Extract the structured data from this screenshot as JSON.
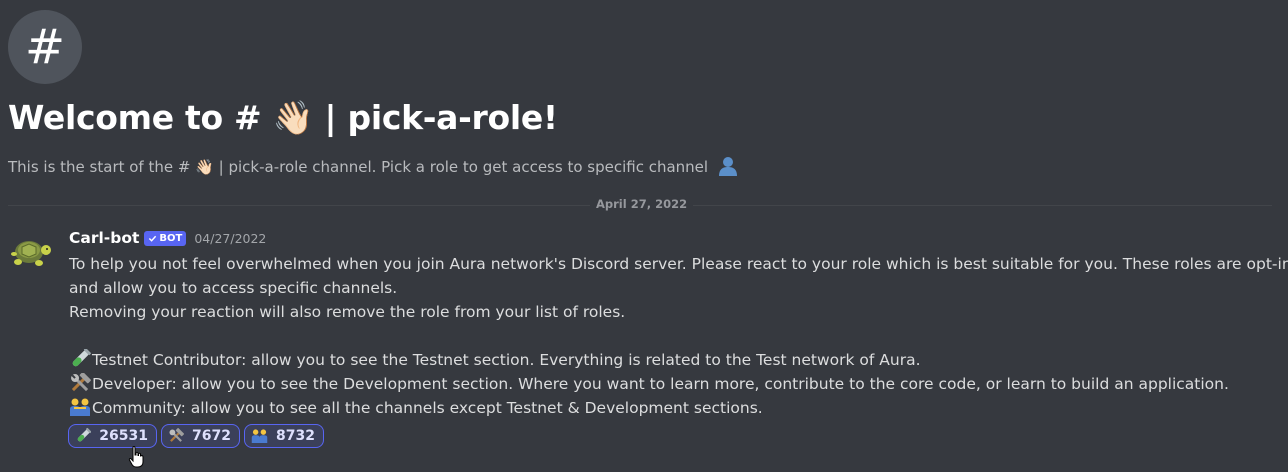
{
  "welcome": {
    "title": "Welcome to # 👋🏻 | pick-a-role!",
    "subtitle": "This is the start of the # 👋🏻 | pick-a-role channel. Pick a role to get access to specific channel"
  },
  "divider": {
    "date": "April 27, 2022"
  },
  "message": {
    "author": "Carl-bot",
    "bot_tag": "BOT",
    "timestamp": "04/27/2022",
    "lines": [
      "To help you not feel overwhelmed when you join Aura network's Discord server. Please react to your role which is best suitable for you. These roles are opt-in,",
      "and allow you to access specific channels.",
      "Removing your reaction will also remove the role from your list of roles."
    ],
    "roles": [
      {
        "icon": "test-tube-icon",
        "text": "Testnet Contributor: allow you to see the Testnet section. Everything is related to the Test network of Aura."
      },
      {
        "icon": "hammer-wrench-icon",
        "text": "Developer: allow you to see the Development section. Where you want to learn more, contribute to the core code, or learn to build an application."
      },
      {
        "icon": "people-icon",
        "text": "Community: allow you to see all the channels except Testnet & Development sections."
      }
    ]
  },
  "reactions": [
    {
      "icon": "test-tube-icon",
      "count": "26531"
    },
    {
      "icon": "hammer-wrench-icon",
      "count": "7672"
    },
    {
      "icon": "people-icon",
      "count": "8732"
    }
  ],
  "colors": {
    "background": "#36393f",
    "accent": "#5865f2",
    "reaction_bg": "#3b405a"
  }
}
